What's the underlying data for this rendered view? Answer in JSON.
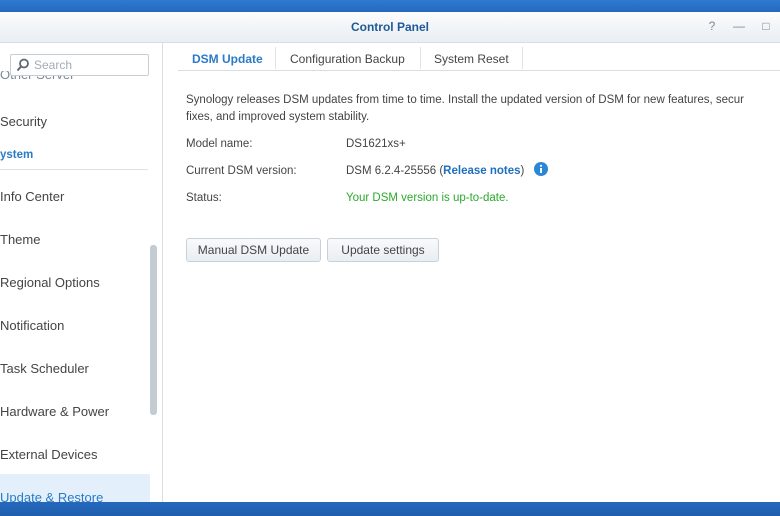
{
  "window": {
    "title": "Control Panel",
    "help_glyph": "?",
    "minimize_glyph": "—",
    "maximize_glyph": "□"
  },
  "sidebar": {
    "search_placeholder": "Search",
    "cut_item": "Other Server",
    "items_top": [
      {
        "label": "Security"
      }
    ],
    "section": "ystem",
    "items": [
      {
        "label": "Info Center"
      },
      {
        "label": "Theme"
      },
      {
        "label": "Regional Options"
      },
      {
        "label": "Notification"
      },
      {
        "label": "Task Scheduler"
      },
      {
        "label": "Hardware & Power"
      },
      {
        "label": "External Devices"
      },
      {
        "label": "Update & Restore",
        "active": true
      }
    ]
  },
  "tabs": [
    {
      "label": "DSM Update",
      "active": true
    },
    {
      "label": "Configuration Backup"
    },
    {
      "label": "System Reset"
    }
  ],
  "content": {
    "description_line1": "Synology releases DSM updates from time to time. Install the updated version of DSM for new features, secur",
    "description_line2": "fixes, and improved system stability.",
    "model_label": "Model name:",
    "model_value": "DS1621xs+",
    "version_label": "Current DSM version:",
    "version_value": "DSM 6.2.4-25556 (",
    "release_notes": "Release notes",
    "version_close": ")",
    "status_label": "Status:",
    "status_value": "Your DSM version is up-to-date."
  },
  "buttons": {
    "manual_update": "Manual DSM Update",
    "update_settings": "Update settings"
  },
  "colors": {
    "accent": "#2a7ac8",
    "status_ok": "#2aaa2a",
    "desktop": "#2a6fc4"
  }
}
